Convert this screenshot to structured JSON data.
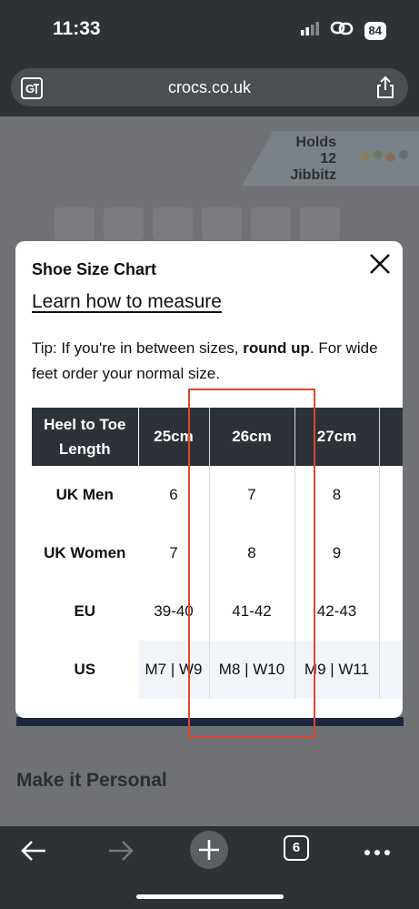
{
  "status_bar": {
    "time": "11:33",
    "battery": "84"
  },
  "browser": {
    "url": "crocs.co.uk",
    "tab_count": "6"
  },
  "page": {
    "jibbitz_line1": "Holds",
    "jibbitz_line2": "12 Jibbitz",
    "section_title": "Make it Personal"
  },
  "modal": {
    "title": "Shoe Size Chart",
    "learn_link": "Learn how to measure",
    "tip_prefix": "Tip: If you're in between sizes, ",
    "tip_bold": "round up",
    "tip_suffix": ". For wide feet order your normal size.",
    "table": {
      "row_header": [
        "Heel to Toe",
        "Length"
      ],
      "columns": [
        "25cm",
        "26cm",
        "27cm"
      ],
      "rows": [
        {
          "label": "UK Men",
          "values": [
            "6",
            "7",
            "8"
          ]
        },
        {
          "label": "UK Women",
          "values": [
            "7",
            "8",
            "9"
          ]
        },
        {
          "label": "EU",
          "values": [
            "39-40",
            "41-42",
            "42-43"
          ]
        },
        {
          "label": "US",
          "values": [
            "M7 | W9",
            "M8 | W10",
            "M9 | W11"
          ]
        }
      ]
    }
  },
  "colors": {
    "highlight": "#e2452c",
    "table_header": "#2c3237",
    "backdrop": "#6f7174"
  }
}
